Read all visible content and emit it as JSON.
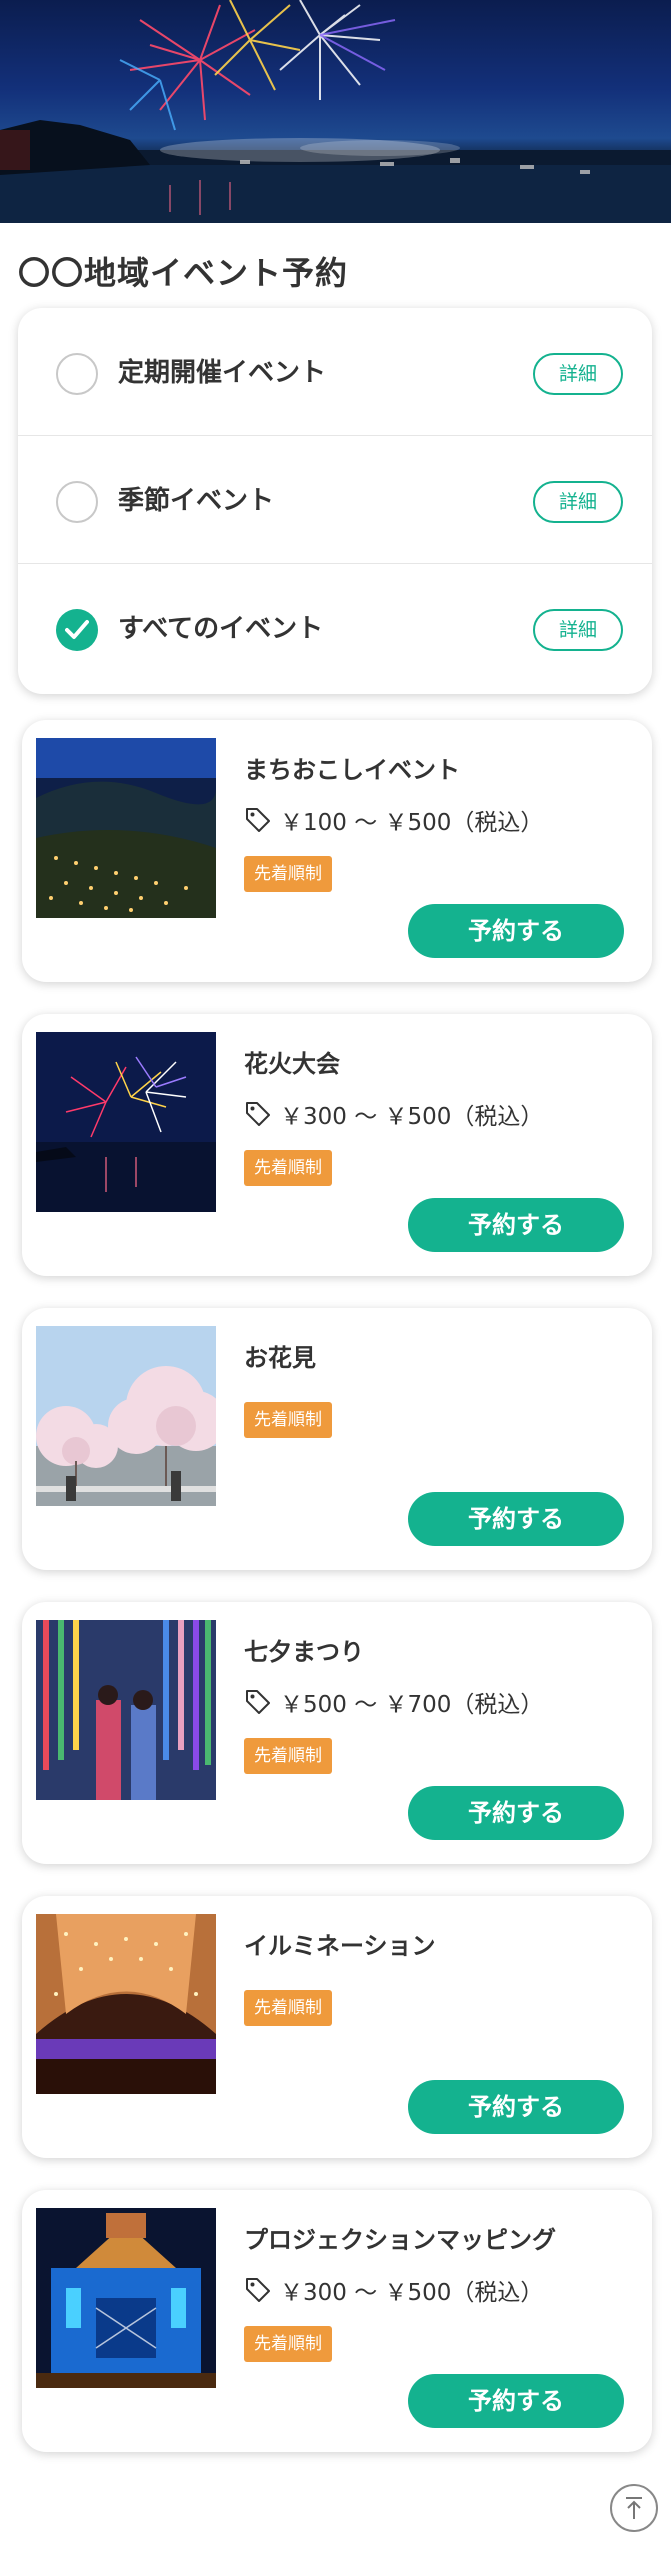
{
  "hero": {
    "icon": "fireworks-banner-image"
  },
  "page_title": "〇〇地域イベント予約",
  "filters": [
    {
      "label": "定期開催イベント",
      "detail_label": "詳細",
      "checked": false
    },
    {
      "label": "季節イベント",
      "detail_label": "詳細",
      "checked": false
    },
    {
      "label": "すべてのイベント",
      "detail_label": "詳細",
      "checked": true
    }
  ],
  "events": [
    {
      "name": "まちおこしイベント",
      "price": "￥100 〜 ￥500（税込）",
      "badge": "先着順制",
      "button": "予約する",
      "image": "rice-terrace-lanterns"
    },
    {
      "name": "花火大会",
      "price": "￥300 〜 ￥500（税込）",
      "badge": "先着順制",
      "button": "予約する",
      "image": "fireworks"
    },
    {
      "name": "お花見",
      "price": null,
      "badge": "先着順制",
      "button": "予約する",
      "image": "cherry-blossoms"
    },
    {
      "name": "七夕まつり",
      "price": "￥500 〜 ￥700（税込）",
      "badge": "先着順制",
      "button": "予約する",
      "image": "tanabata-decorations"
    },
    {
      "name": "イルミネーション",
      "price": null,
      "badge": "先着順制",
      "button": "予約する",
      "image": "light-tunnel"
    },
    {
      "name": "プロジェクションマッピング",
      "price": "￥300 〜 ￥500（税込）",
      "badge": "先着順制",
      "button": "予約する",
      "image": "projection-building"
    }
  ],
  "colors": {
    "accent": "#14b28f",
    "badge": "#ef9a3c",
    "text": "#333333"
  },
  "scroll_top": {
    "icon": "arrow-up-to-top-icon"
  }
}
